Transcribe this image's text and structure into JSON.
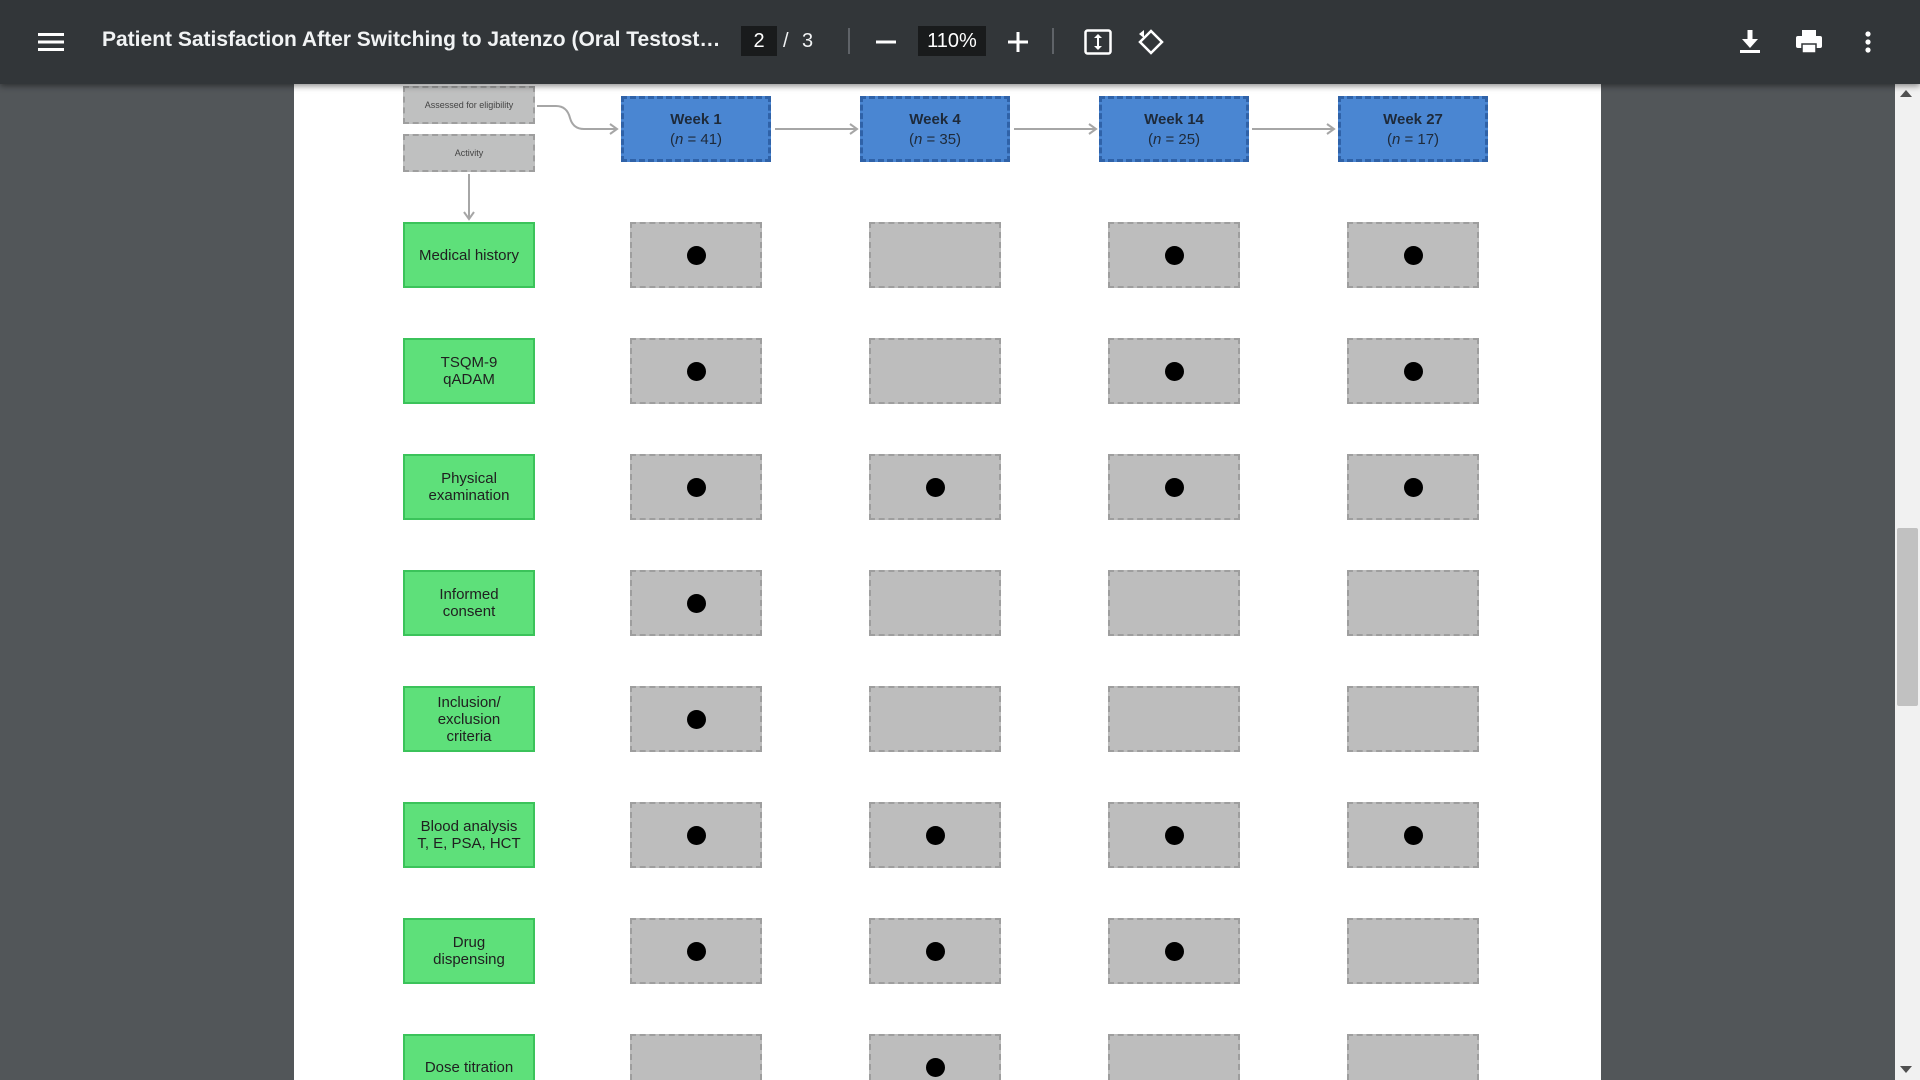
{
  "toolbar": {
    "title": "Patient Satisfaction After Switching to Jatenzo (Oral Testostero...",
    "current_page": "2",
    "page_separator": "/",
    "total_pages": "3",
    "zoom": "110%",
    "icons": [
      "menu-icon",
      "zoom-out-icon",
      "zoom-in-icon",
      "fit-page-icon",
      "rotate-icon",
      "download-icon",
      "print-icon",
      "more-vert-icon"
    ]
  },
  "header": {
    "eligibility_label": "Assessed for eligibility",
    "activity_label": "Activity"
  },
  "weeks": [
    {
      "name": "Week 1",
      "n_prefix": "(",
      "n_var": "n",
      "n_value": " = 41)"
    },
    {
      "name": "Week 4",
      "n_prefix": "(",
      "n_var": "n",
      "n_value": " = 35)"
    },
    {
      "name": "Week 14",
      "n_prefix": "(",
      "n_var": "n",
      "n_value": " = 25)"
    },
    {
      "name": "Week 27",
      "n_prefix": "(",
      "n_var": "n",
      "n_value": " = 17)"
    }
  ],
  "activities": [
    {
      "label": "Medical history",
      "marks": [
        true,
        false,
        true,
        true
      ]
    },
    {
      "label": "TSQM-9\nqADAM",
      "marks": [
        true,
        false,
        true,
        true
      ]
    },
    {
      "label": "Physical\nexamination",
      "marks": [
        true,
        true,
        true,
        true
      ]
    },
    {
      "label": "Informed\nconsent",
      "marks": [
        true,
        false,
        false,
        false
      ]
    },
    {
      "label": "Inclusion/\nexclusion\ncriteria",
      "marks": [
        true,
        false,
        false,
        false
      ]
    },
    {
      "label": "Blood analysis\nT, E, PSA, HCT",
      "marks": [
        true,
        true,
        true,
        true
      ]
    },
    {
      "label": "Drug\ndispensing",
      "marks": [
        true,
        true,
        true,
        false
      ]
    },
    {
      "label": "Dose titration",
      "marks": [
        false,
        true,
        false,
        false
      ]
    }
  ],
  "colors": {
    "toolbar": "#323639",
    "week_box": "#4a86d2",
    "activity_box": "#5ee07a",
    "cell": "#bdbdbd"
  }
}
